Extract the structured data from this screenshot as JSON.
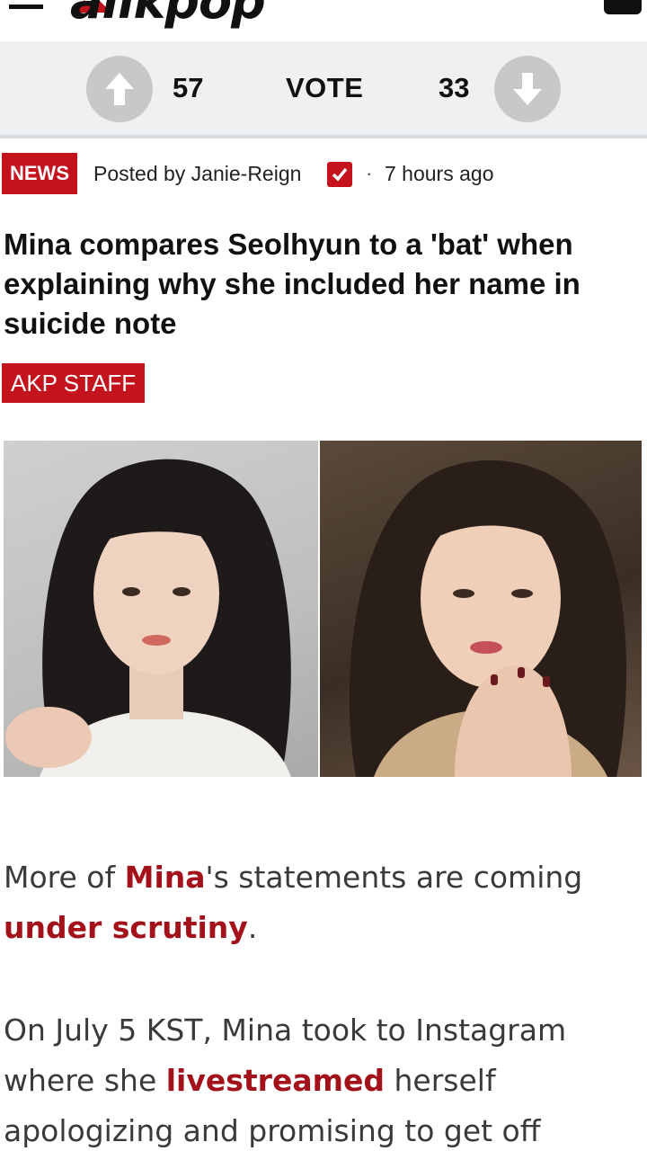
{
  "header": {
    "logo_text": "allkpop",
    "menu_icon": "hamburger-menu-icon",
    "user_icon": "user-icon"
  },
  "vote": {
    "up_count": "57",
    "label": "VOTE",
    "down_count": "33",
    "up_icon": "arrow-up-icon",
    "down_icon": "arrow-down-icon"
  },
  "meta": {
    "category": "NEWS",
    "posted_by": "Posted by Janie-Reign",
    "separator": "·",
    "time_ago": "7 hours ago"
  },
  "article": {
    "headline": "Mina compares Seolhyun to a 'bat' when explaining why she included her name in suicide note",
    "staff_tag": "AKP STAFF",
    "image_alt": "Mina and Seolhyun side by side",
    "p1": {
      "t1": "More of ",
      "k1": "Mina",
      "t2": "'s statements are coming ",
      "k2": "under scrutiny",
      "t3": "."
    },
    "p2": {
      "t1": "On July 5 KST, Mina took to Instagram where she ",
      "k1": "livestreamed",
      "t2": " herself apologizing and promising to get off"
    }
  },
  "colors": {
    "accent": "#c4131c",
    "keyword": "#a3121a",
    "vote_bar_bg": "#eef0f1",
    "vote_button": "#c6c8ca"
  }
}
